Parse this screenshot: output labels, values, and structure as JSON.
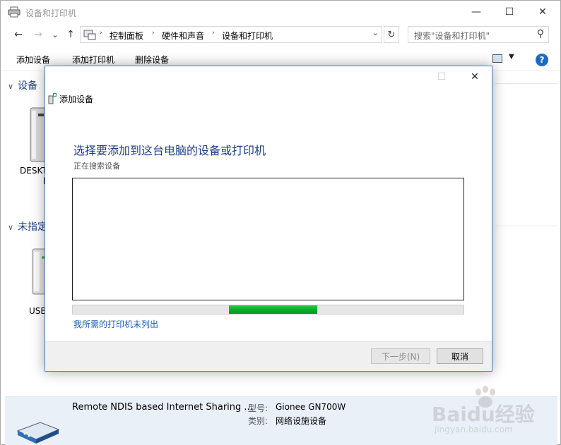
{
  "window": {
    "title": "设备和打印机",
    "minimize": "—",
    "maximize": "☐",
    "close": "✕"
  },
  "nav": {
    "back": "←",
    "forward": "→",
    "recent": "⌄",
    "up": "↑",
    "breadcrumbs": [
      "控制面板",
      "硬件和声音",
      "设备和打印机"
    ],
    "separator": "›",
    "dropdown": "⌄",
    "refresh": "↻",
    "search_placeholder": "搜索\"设备和打印机\"",
    "search_icon": "⚲"
  },
  "commands": {
    "add_device": "添加设备",
    "add_printer": "添加打印机",
    "remove_device": "删除设备",
    "view_dropdown": "▼",
    "help": "?"
  },
  "groups": {
    "devices": {
      "chevron": "∨",
      "label": "设备",
      "item_label": "DESKT",
      "item_label2": "l"
    },
    "unspecified": {
      "chevron": "∨",
      "label": "未指定",
      "item_label": "USB"
    }
  },
  "details": {
    "name": "Remote NDIS based Internet Sharing ...",
    "model_key": "型号:",
    "model_value": "Gionee GN700W",
    "category_key": "类别:",
    "category_value": "网络设施设备"
  },
  "dialog": {
    "maximize": "☐",
    "close": "✕",
    "header": "添加设备",
    "heading": "选择要添加到这台电脑的设备或打印机",
    "status": "正在搜索设备",
    "progress_start": 0.4,
    "progress_end": 0.625,
    "not_listed_link": "我所需的打印机未列出",
    "next_button": "下一步(N)",
    "cancel_button": "取消"
  },
  "watermark": {
    "brand": "Baidu经验",
    "url": "jingyan.baidu.com"
  },
  "colors": {
    "accent": "#1a3d8a",
    "link": "#1a5fb4",
    "progress": "#06b025",
    "details_bg": "#e9f0f8"
  }
}
